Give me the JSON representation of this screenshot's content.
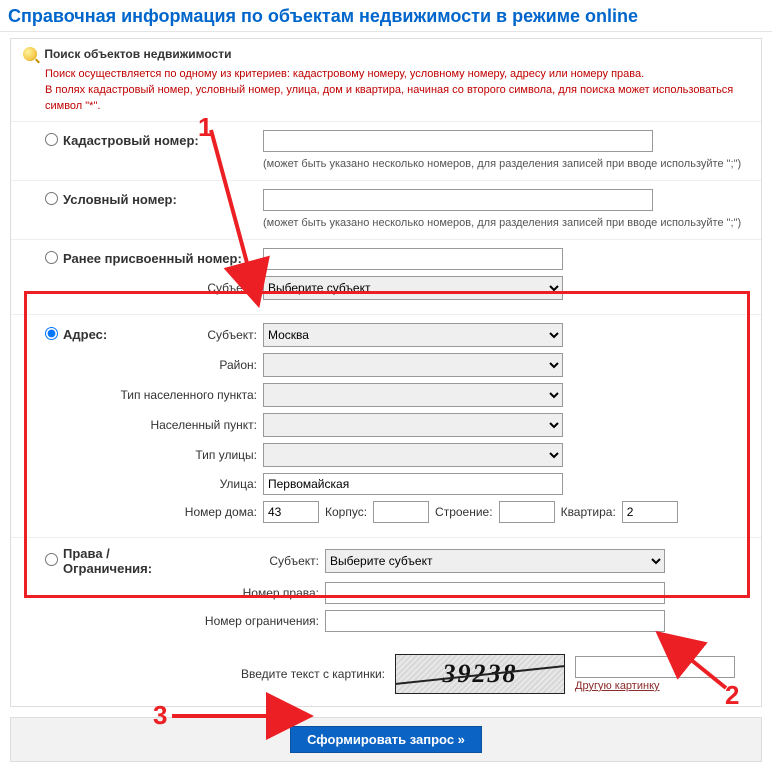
{
  "page_title": "Справочная информация по объектам недвижимости в режиме online",
  "search_panel": {
    "header": "Поиск объектов недвижимости",
    "hint1": "Поиск осуществляется по одному из критериев: кадастровому номеру, условному номеру, адресу или номеру права.",
    "hint2": "В полях кадастровый номер, условный номер, улица, дом и квартира, начиная со второго символа, для поиска может использоваться символ \"*\"."
  },
  "criteria": {
    "cadastral": {
      "label": "Кадастровый номер:",
      "value": "",
      "hint": "(может быть указано несколько номеров, для разделения записей при вводе используйте \";\")"
    },
    "conditional": {
      "label": "Условный номер:",
      "value": "",
      "hint": "(может быть указано несколько номеров, для разделения записей при вводе используйте \";\")"
    },
    "previous": {
      "label": "Ранее присвоенный номер:",
      "value": "",
      "subject_label": "Субъект:",
      "subject_value": "Выберите субъект"
    },
    "address": {
      "label": "Адрес:",
      "subject_label": "Субъект:",
      "subject_value": "Москва",
      "district_label": "Район:",
      "district_value": "",
      "settlement_type_label": "Тип населенного пункта:",
      "settlement_type_value": "",
      "settlement_label": "Населенный пункт:",
      "settlement_value": "",
      "street_type_label": "Тип улицы:",
      "street_type_value": "",
      "street_label": "Улица:",
      "street_value": "Первомайская",
      "house_label": "Номер дома:",
      "house_value": "43",
      "building_label": "Корпус:",
      "building_value": "",
      "structure_label": "Строение:",
      "structure_value": "",
      "flat_label": "Квартира:",
      "flat_value": "2"
    },
    "rights": {
      "label": "Права / Ограничения:",
      "subject_label": "Субъект:",
      "subject_value": "Выберите субъект",
      "right_num_label": "Номер права:",
      "right_num_value": "",
      "limit_num_label": "Номер ограничения:",
      "limit_num_value": ""
    }
  },
  "captcha": {
    "label": "Введите текст с картинки:",
    "image_text": "39238",
    "input_value": "",
    "refresh_link": "Другую картинку"
  },
  "submit_label": "Сформировать запрос »",
  "annotations": {
    "n1": "1",
    "n2": "2",
    "n3": "3"
  }
}
